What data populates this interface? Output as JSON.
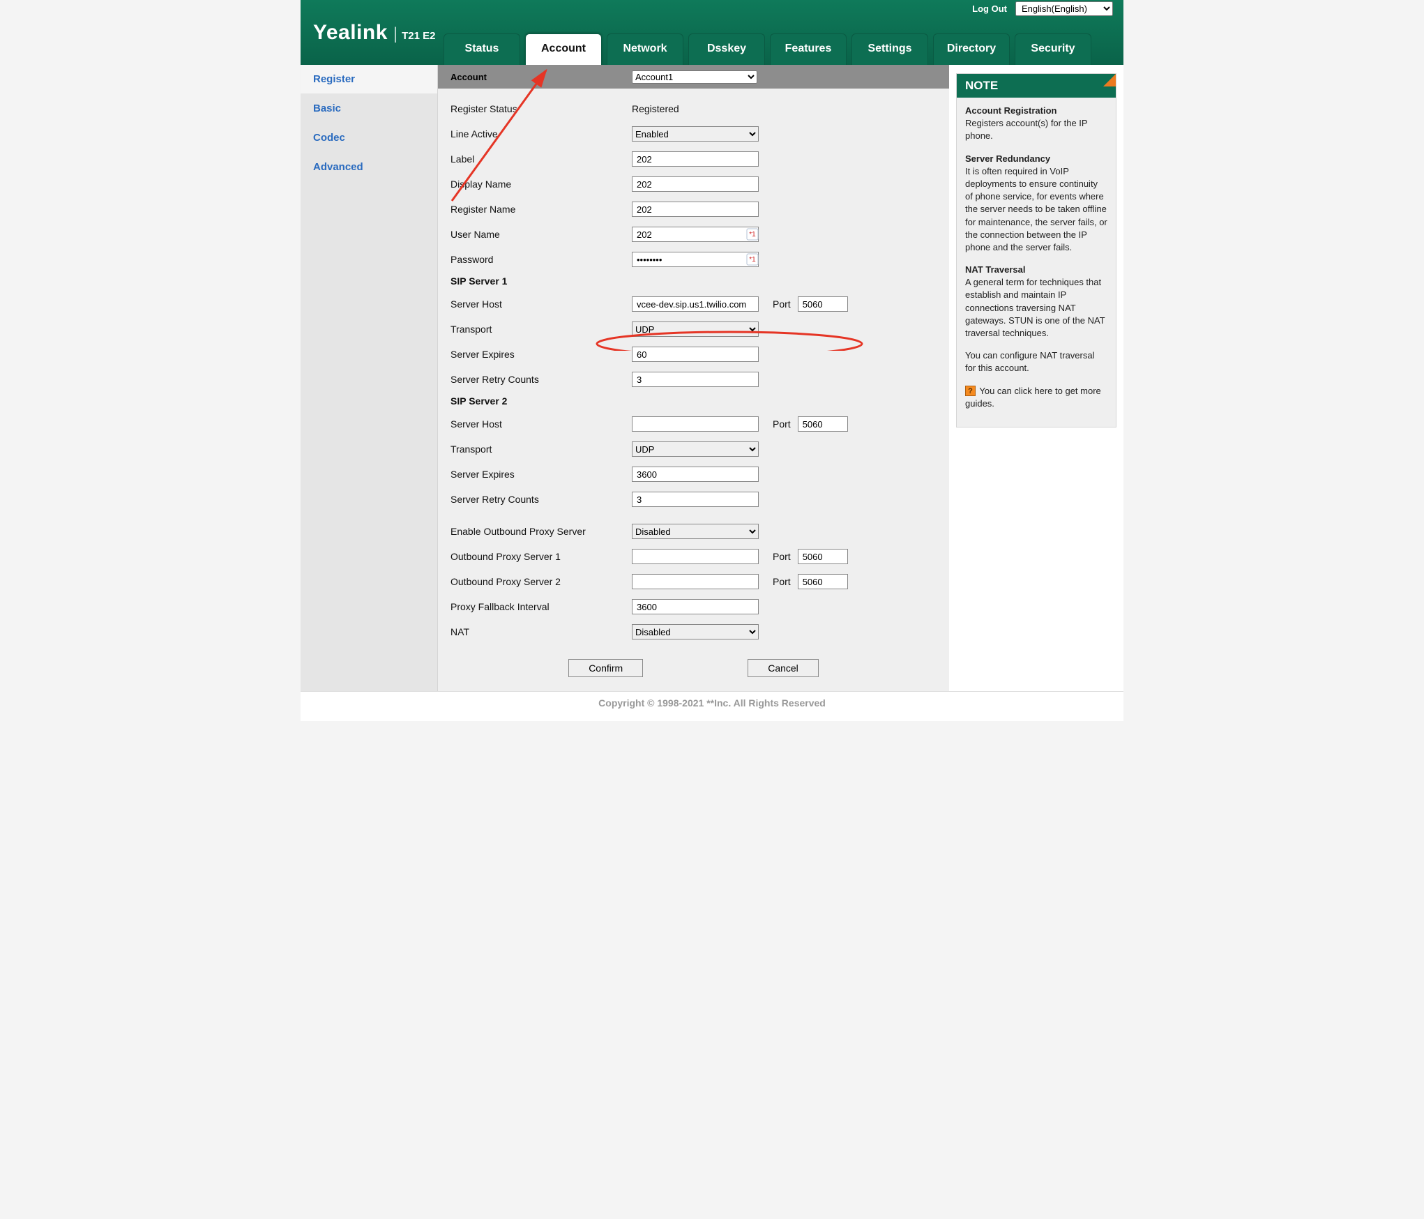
{
  "topbar": {
    "logout": "Log Out",
    "language": "English(English)"
  },
  "logo": {
    "brand": "Yealink",
    "model": "T21 E2"
  },
  "tabs": [
    "Status",
    "Account",
    "Network",
    "Dsskey",
    "Features",
    "Settings",
    "Directory",
    "Security"
  ],
  "active_tab": "Account",
  "sidebar": [
    "Register",
    "Basic",
    "Codec",
    "Advanced"
  ],
  "active_side": "Register",
  "section": {
    "account_label": "Account",
    "account_select": "Account1"
  },
  "fields": {
    "register_status_label": "Register Status",
    "register_status_value": "Registered",
    "line_active_label": "Line Active",
    "line_active_value": "Enabled",
    "label_label": "Label",
    "label_value": "202",
    "display_name_label": "Display Name",
    "display_name_value": "202",
    "register_name_label": "Register Name",
    "register_name_value": "202",
    "user_name_label": "User Name",
    "user_name_value": "202",
    "password_label": "Password",
    "password_value": "••••••••",
    "sip1_head": "SIP Server 1",
    "sip1_host_label": "Server Host",
    "sip1_host_value": "vcee-dev.sip.us1.twilio.com",
    "sip1_port_label": "Port",
    "sip1_port_value": "5060",
    "sip1_transport_label": "Transport",
    "sip1_transport_value": "UDP",
    "sip1_expires_label": "Server Expires",
    "sip1_expires_value": "60",
    "sip1_retry_label": "Server Retry Counts",
    "sip1_retry_value": "3",
    "sip2_head": "SIP Server 2",
    "sip2_host_label": "Server Host",
    "sip2_host_value": "",
    "sip2_port_label": "Port",
    "sip2_port_value": "5060",
    "sip2_transport_label": "Transport",
    "sip2_transport_value": "UDP",
    "sip2_expires_label": "Server Expires",
    "sip2_expires_value": "3600",
    "sip2_retry_label": "Server Retry Counts",
    "sip2_retry_value": "3",
    "outbound_enable_label": "Enable Outbound Proxy Server",
    "outbound_enable_value": "Disabled",
    "outbound1_label": "Outbound Proxy Server 1",
    "outbound1_value": "",
    "outbound1_port_label": "Port",
    "outbound1_port_value": "5060",
    "outbound2_label": "Outbound Proxy Server 2",
    "outbound2_value": "",
    "outbound2_port_label": "Port",
    "outbound2_port_value": "5060",
    "proxy_fallback_label": "Proxy Fallback Interval",
    "proxy_fallback_value": "3600",
    "nat_label": "NAT",
    "nat_value": "Disabled"
  },
  "buttons": {
    "confirm": "Confirm",
    "cancel": "Cancel"
  },
  "note": {
    "title": "NOTE",
    "reg_head": "Account Registration",
    "reg_body": "Registers account(s) for the IP phone.",
    "red_head": "Server Redundancy",
    "red_body": "It is often required in VoIP deployments to ensure continuity of phone service, for events where the server needs to be taken offline for maintenance, the server fails, or the connection between the IP phone and the server fails.",
    "nat_head": "NAT Traversal",
    "nat_body": "A general term for techniques that establish and maintain IP connections traversing NAT gateways. STUN is one of the NAT traversal techniques.",
    "nat_configure": "You can configure NAT traversal for this account.",
    "guides": " You can click here to get more guides."
  },
  "footer": "Copyright © 1998-2021 **Inc. All Rights Reserved"
}
